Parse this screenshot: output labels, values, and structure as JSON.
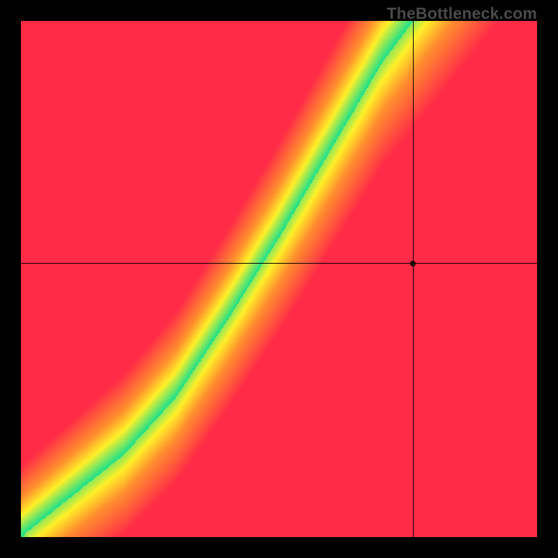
{
  "watermark": "TheBottleneck.com",
  "chart_data": {
    "type": "heatmap",
    "title": "",
    "xlabel": "",
    "ylabel": "",
    "xlim": [
      0,
      100
    ],
    "ylim": [
      0,
      100
    ],
    "ridge": {
      "description": "optimal-balance curve (green band center)",
      "points": [
        {
          "x": 0,
          "y": 0
        },
        {
          "x": 10,
          "y": 8
        },
        {
          "x": 20,
          "y": 16
        },
        {
          "x": 30,
          "y": 27
        },
        {
          "x": 40,
          "y": 42
        },
        {
          "x": 50,
          "y": 58
        },
        {
          "x": 60,
          "y": 75
        },
        {
          "x": 70,
          "y": 92
        },
        {
          "x": 76,
          "y": 100
        }
      ]
    },
    "marker": {
      "x": 76,
      "y": 53
    },
    "colorscale": [
      {
        "stop": 0.0,
        "color": "#ff2b47"
      },
      {
        "stop": 0.45,
        "color": "#ff8f2e"
      },
      {
        "stop": 0.7,
        "color": "#fff028"
      },
      {
        "stop": 1.0,
        "color": "#18e08c"
      }
    ],
    "grid": false,
    "legend": false
  },
  "layout": {
    "canvas": {
      "left": 30,
      "top": 30,
      "size": 740
    }
  }
}
